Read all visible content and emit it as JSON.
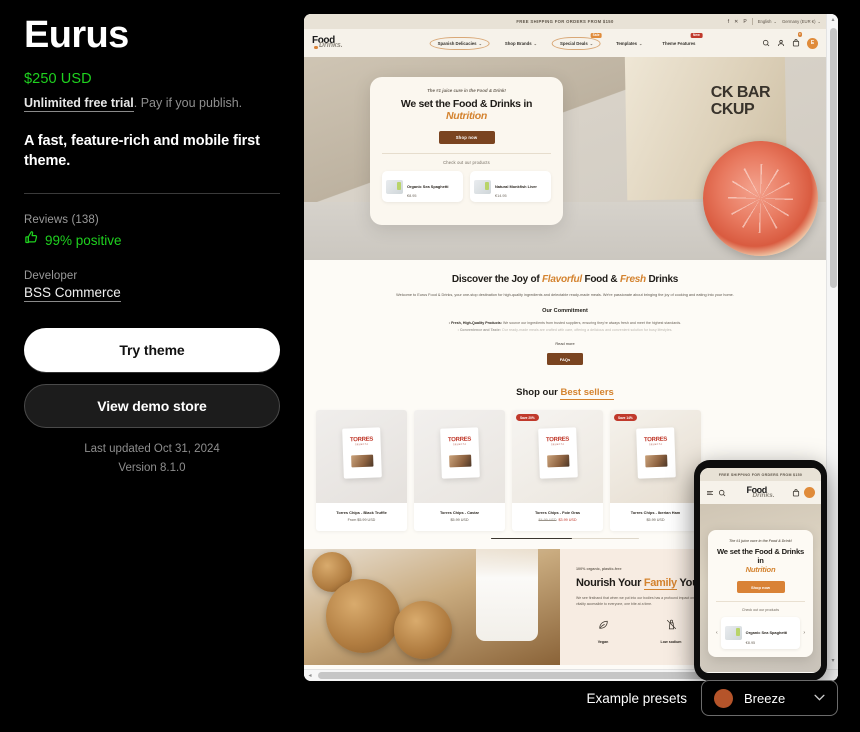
{
  "theme": {
    "name": "Eurus",
    "price": "$250 USD",
    "trial_link": "Unlimited free trial",
    "trial_rest": ". Pay if you publish.",
    "tagline": "A fast, feature-rich and mobile first theme.",
    "reviews_label": "Reviews (138)",
    "rating": "99% positive",
    "developer_label": "Developer",
    "developer_name": "BSS Commerce",
    "try_button": "Try theme",
    "demo_button": "View demo store",
    "last_updated": "Last updated Oct 31, 2024",
    "version": "Version 8.1.0",
    "accent_green": "#1fd11f"
  },
  "presets": {
    "label": "Example presets",
    "selected": "Breeze",
    "swatch_color": "#b5542a",
    "caret": "⌄"
  },
  "preview": {
    "announcement": "FREE SHIPPING FOR ORDERS FROM $150",
    "socials": [
      "f",
      "✕",
      "P"
    ],
    "language": "English",
    "currency": "Germany (EUR €)",
    "logo": {
      "line1": "Food",
      "line2": "Drinks."
    },
    "nav": [
      {
        "label": "Spanish Delicacies",
        "caret": "⌄",
        "circled": true,
        "badge": null
      },
      {
        "label": "Shop Brands",
        "caret": "⌄",
        "circled": false,
        "badge": null
      },
      {
        "label": "Special Deals",
        "caret": "⌄",
        "circled": true,
        "badge": "Sale"
      },
      {
        "label": "Templates",
        "caret": "⌄",
        "circled": false,
        "badge": null
      },
      {
        "label": "Theme Features",
        "caret": "",
        "circled": false,
        "badge": "New"
      }
    ],
    "cart_count": "0",
    "avatar_initial": "E",
    "hero": {
      "eyebrow": "The #1 juice cure in the Food & Drink!",
      "headline_1": "We set the Food & Drinks in",
      "headline_accent": "Nutrition",
      "cta": "Shop now",
      "checkout_label": "Check out our products",
      "products": [
        {
          "name": "Organic Sea Spaghetti",
          "price": "€8.95"
        },
        {
          "name": "Natural Monkfish Liver",
          "price": "€14.95"
        }
      ],
      "backdrop_text": "CK BAR\nCKUP"
    },
    "discover": {
      "head_1": "Discover the Joy of ",
      "head_accent_1": "Flavorful",
      "head_2": " Food & ",
      "head_accent_2": "Fresh",
      "head_3": " Drinks",
      "paragraph": "Welcome to Eurus Food & Drinks, your one-stop destination for high-quality ingredients and delectable ready-made meals. We're passionate about bringing the joy of cooking and eating into your home.",
      "commitment_title": "Our Commitment",
      "commitments": [
        {
          "bold": "Fresh, High-Quality Products:",
          "rest": " We source our ingredients from trusted suppliers, ensuring they're always fresh and meet the highest standards."
        },
        {
          "bold": "Convenience and Taste:",
          "rest": " Our ready-made meals are crafted with care, offering a delicious and convenient solution for busy lifestyles."
        }
      ],
      "read_more": "Read more",
      "faq_button": "FAQs"
    },
    "best_sellers": {
      "head_1": "Shop our ",
      "head_accent": "Best sellers",
      "products": [
        {
          "name": "Torres Chips - Black Truffle",
          "price": "From $5.99 USD",
          "badge": null,
          "old_price": null,
          "sale_price": null
        },
        {
          "name": "Torres Chips - Caviar",
          "price": "$5.99 USD",
          "badge": null,
          "old_price": null,
          "sale_price": null
        },
        {
          "name": "Torres Chips - Foie Gras",
          "price": null,
          "badge": "Save 20%",
          "old_price": "$4.99 USD",
          "sale_price": "$3.99 USD"
        },
        {
          "name": "Torres Chips - Iberian Ham",
          "price": "$5.99 USD",
          "badge": "Save 14%",
          "old_price": null,
          "sale_price": null
        }
      ],
      "brand_logo": "TORRES",
      "brand_sub": "SELECTA"
    },
    "nourish": {
      "eyebrow": "100% organic, plastic-free",
      "head_1": "Nourish Your ",
      "head_accent": "Family",
      "head_2": " You",
      "paragraph": "We see firsthand that when we put into our bodies has a profound impact on our well-being. It's our passion to make the connection between food and vitality accessible to everyone, one bite at a time.",
      "features": [
        {
          "icon": "leaf-icon",
          "label": "Vegan"
        },
        {
          "icon": "salt-shaker-icon",
          "label": "Low sodium"
        }
      ]
    },
    "mobile": {
      "announcement": "FREE SHIPPING FOR ORDERS FROM $150",
      "logo": {
        "line1": "Food",
        "line2": "Drinks."
      },
      "eyebrow": "The #1 juice cure in the Food & Drink!",
      "headline_1": "We set the Food & Drinks in",
      "headline_accent": "Nutrition",
      "cta": "Shop now",
      "checkout_label": "Check out our products",
      "product": {
        "name": "Organic Sea Spaghetti",
        "price": "€8.95"
      },
      "prev_arrow": "‹",
      "next_arrow": "›",
      "avatar_initial": "E"
    },
    "scroll": {
      "up": "▴",
      "down": "▾",
      "left": "◂",
      "right": "▸"
    }
  }
}
